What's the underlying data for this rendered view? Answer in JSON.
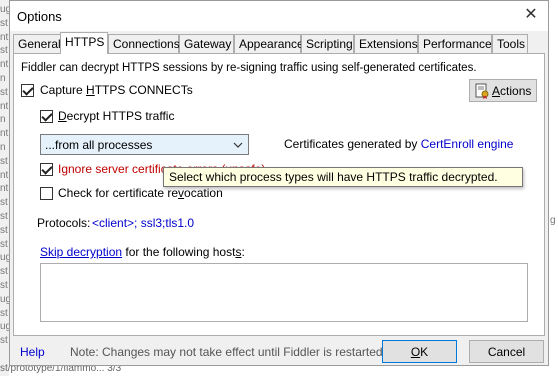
{
  "window": {
    "title": "Options",
    "close_glyph": "✕"
  },
  "tabs": [
    {
      "label": "General",
      "active": false
    },
    {
      "label": "HTTPS",
      "active": true
    },
    {
      "label": "Connections",
      "active": false
    },
    {
      "label": "Gateway",
      "active": false
    },
    {
      "label": "Appearance",
      "active": false
    },
    {
      "label": "Scripting",
      "active": false
    },
    {
      "label": "Extensions",
      "active": false
    },
    {
      "label": "Performance",
      "active": false
    },
    {
      "label": "Tools",
      "active": false
    }
  ],
  "https": {
    "intro": "Fiddler can decrypt HTTPS sessions by re-signing traffic using self-generated certificates.",
    "capture_connects": {
      "label_pre": "Capture ",
      "label_accel": "H",
      "label_post": "TTPS CONNECTs",
      "checked": true
    },
    "actions_button": {
      "accel": "A",
      "rest": "ctions"
    },
    "decrypt": {
      "label_pre": "",
      "label_accel": "D",
      "label_post": "ecrypt HTTPS traffic",
      "checked": true
    },
    "process_select": {
      "value": "...from all processes"
    },
    "certs_generated": {
      "label": "Certificates generated by",
      "link": "CertEnroll engine"
    },
    "ignore_errors": {
      "label": "Ignore server certificate errors (unsafe)",
      "checked": true,
      "color": "#c00000"
    },
    "revocation": {
      "label_pre": "Check for certificate re",
      "label_accel": "v",
      "label_post": "ocation",
      "checked": false
    },
    "protocols": {
      "label": "Protocols:",
      "value": "<client>; ssl3;tls1.0"
    },
    "skip": {
      "link": "Skip decryption",
      "rest_pre": " for the following host",
      "rest_accel": "s",
      "rest_post": ":",
      "value": ""
    },
    "tooltip": "Select which process types will have HTTPS traffic decrypted."
  },
  "footer": {
    "help": "Help",
    "note": "Note: Changes may not take effect until Fiddler is restarted.",
    "ok": {
      "accel": "O",
      "rest": "K"
    },
    "cancel": "Cancel"
  },
  "background": {
    "left_fragments": [
      "ug",
      "st",
      "nt",
      "st",
      "nt",
      "n",
      "st",
      "nt",
      "n",
      "nt",
      "n",
      "st",
      "nt",
      "nt",
      "st",
      "st",
      "st",
      "st",
      "ug",
      "st",
      "st",
      "ug",
      "st",
      "ug",
      "st"
    ],
    "right_fragment": "g",
    "bottom_text": "st/prototype/1/flammo...    3/3"
  }
}
